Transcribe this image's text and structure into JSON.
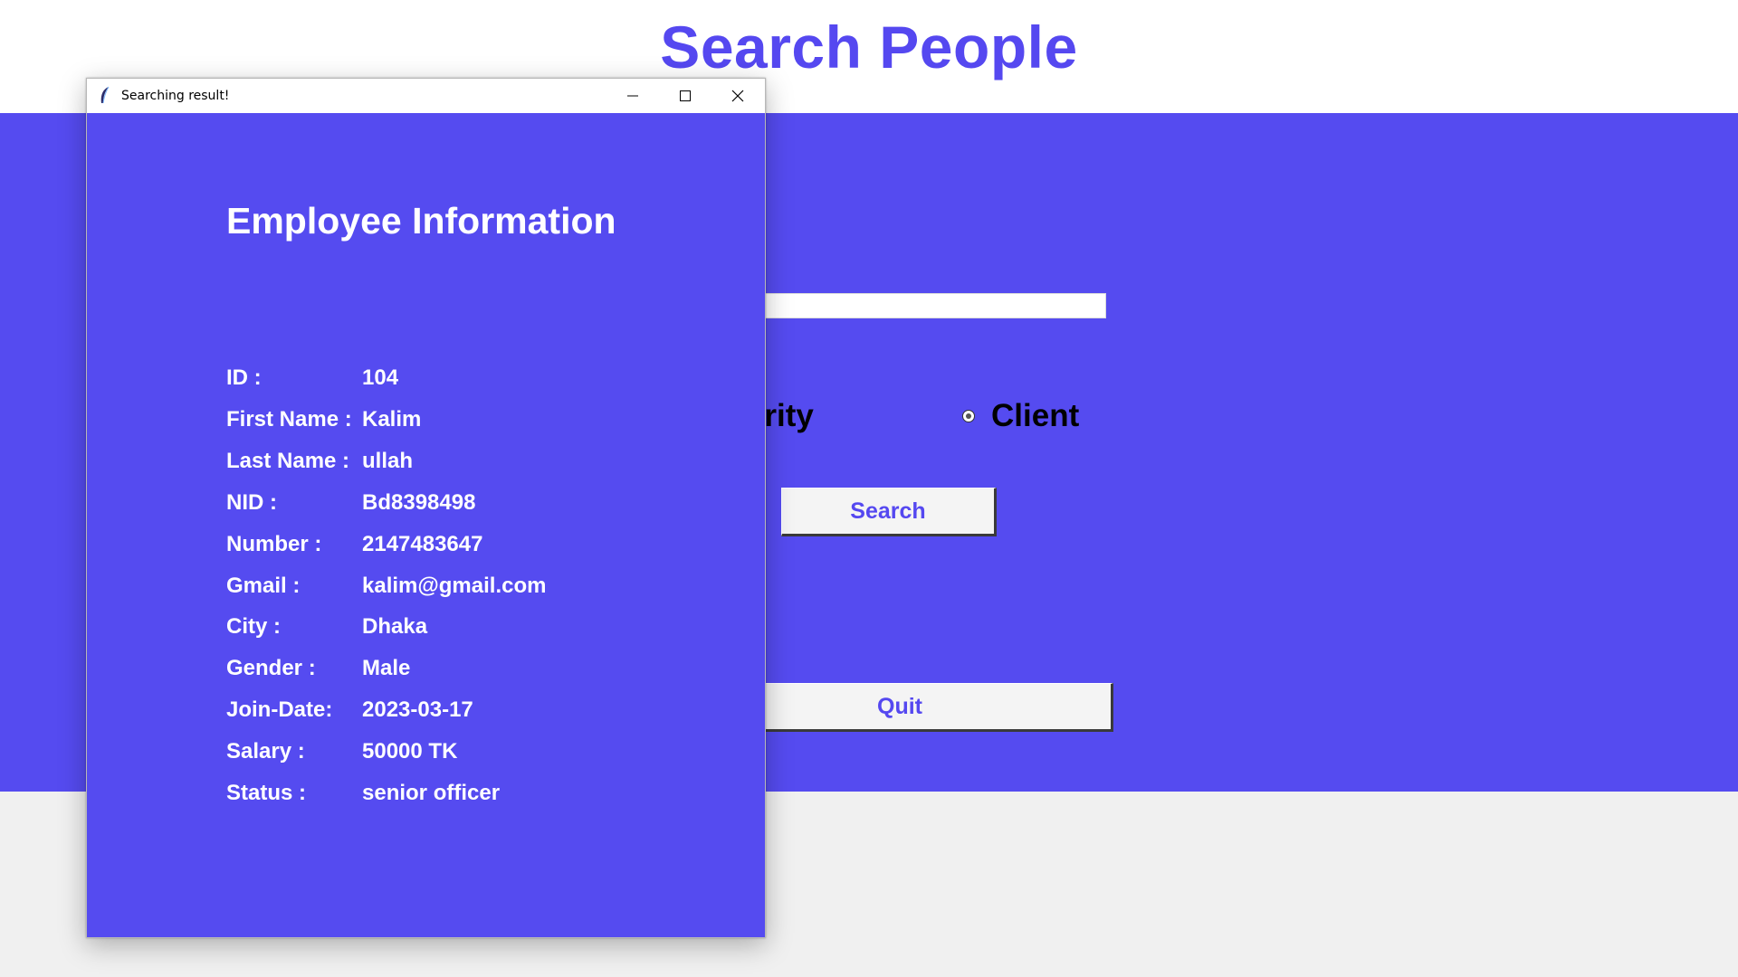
{
  "app": {
    "title": "Search People",
    "radio_partial_label": "thority",
    "radio_client_label": "Client",
    "search_button": "Search",
    "quit_button": "Quit"
  },
  "dialog": {
    "window_title": "Searching result!",
    "heading": "Employee Information",
    "rows": [
      {
        "label": "ID :",
        "value": "104"
      },
      {
        "label": "First Name :",
        "value": "Kalim"
      },
      {
        "label": "Last Name :",
        "value": "ullah"
      },
      {
        "label": "NID :",
        "value": "Bd8398498"
      },
      {
        "label": "Number :",
        "value": "2147483647"
      },
      {
        "label": "Gmail :",
        "value": "kalim@gmail.com"
      },
      {
        "label": "City :",
        "value": "Dhaka"
      },
      {
        "label": "Gender :",
        "value": "Male"
      },
      {
        "label": "Join-Date:",
        "value": "2023-03-17"
      },
      {
        "label": "Salary :",
        "value": "50000 TK"
      },
      {
        "label": "Status :",
        "value": "senior officer"
      }
    ]
  },
  "colors": {
    "accent": "#5548f0",
    "panel_bg": "#554bf0",
    "page_bg": "#f0f0f0"
  },
  "icons": {
    "titlebar": "feather-icon",
    "minimize": "minimize-icon",
    "maximize": "maximize-icon",
    "close": "close-icon"
  }
}
